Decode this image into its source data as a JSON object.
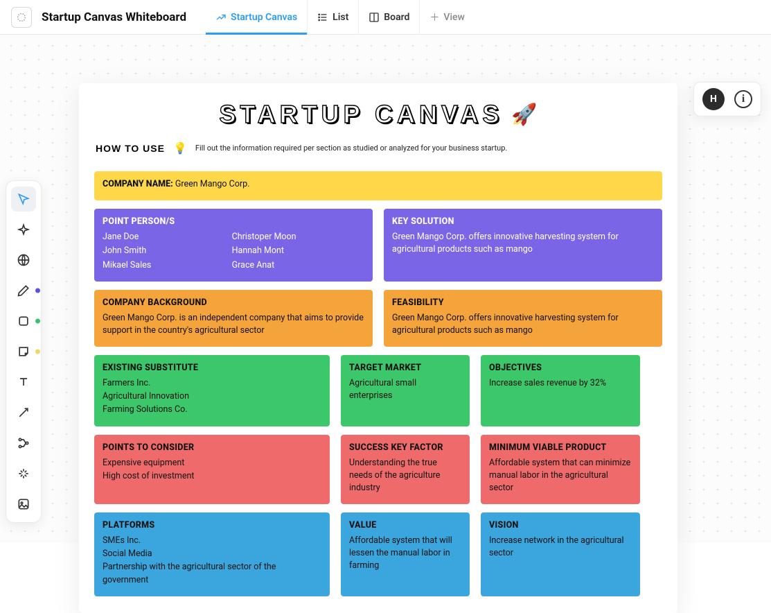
{
  "header": {
    "title": "Startup Canvas Whiteboard",
    "views": {
      "canvas": "Startup Canvas",
      "list": "List",
      "board": "Board",
      "add": "View"
    }
  },
  "user": {
    "initial": "H"
  },
  "canvas": {
    "title": "STARTUP CANVAS",
    "howto_label": "HOW TO USE",
    "howto_text": "Fill out the information required per section as studied or analyzed for your business startup."
  },
  "company": {
    "label": "COMPANY NAME:",
    "value": "Green Mango Corp."
  },
  "point_persons": {
    "heading": "POINT PERSON/S",
    "people": [
      "Jane Doe",
      "Christoper Moon",
      "John Smith",
      "Hannah Mont",
      "Mikael Sales",
      "Grace Anat"
    ]
  },
  "key_solution": {
    "heading": "KEY SOLUTION",
    "body": "Green Mango Corp. offers innovative harvesting system for agricultural products such as mango"
  },
  "background": {
    "heading": "COMPANY BACKGROUND",
    "body": "Green Mango Corp. is an independent company that aims to provide support in the country's agricultural sector"
  },
  "feasibility": {
    "heading": "FEASIBILITY",
    "body": "Green Mango Corp. offers innovative harvesting system for agricultural products such as mango"
  },
  "existing_substitute": {
    "heading": "EXISTING SUBSTITUTE",
    "items": [
      "Farmers Inc.",
      "Agricultural Innovation",
      "Farming Solutions Co."
    ]
  },
  "target_market": {
    "heading": "TARGET MARKET",
    "body": "Agricultural small enterprises"
  },
  "objectives": {
    "heading": "OBJECTIVES",
    "body": "Increase sales revenue by 32%"
  },
  "points_to_consider": {
    "heading": "POINTS TO CONSIDER",
    "items": [
      "Expensive equipment",
      "High cost of investment"
    ]
  },
  "success_factor": {
    "heading": "SUCCESS KEY FACTOR",
    "body": "Understanding the true needs of the agriculture industry"
  },
  "mvp": {
    "heading": "MINIMUM VIABLE PRODUCT",
    "body": "Affordable system that can minimize manual labor in the agricultural sector"
  },
  "platforms": {
    "heading": "PLATFORMS",
    "items": [
      "SMEs Inc.",
      "Social Media",
      "Partnership with the agricultural sector of the government"
    ]
  },
  "value": {
    "heading": "VALUE",
    "body": "Affordable system that will lessen the manual labor in farming"
  },
  "vision": {
    "heading": "VISION",
    "body": "Increase network in the agricultural sector"
  }
}
